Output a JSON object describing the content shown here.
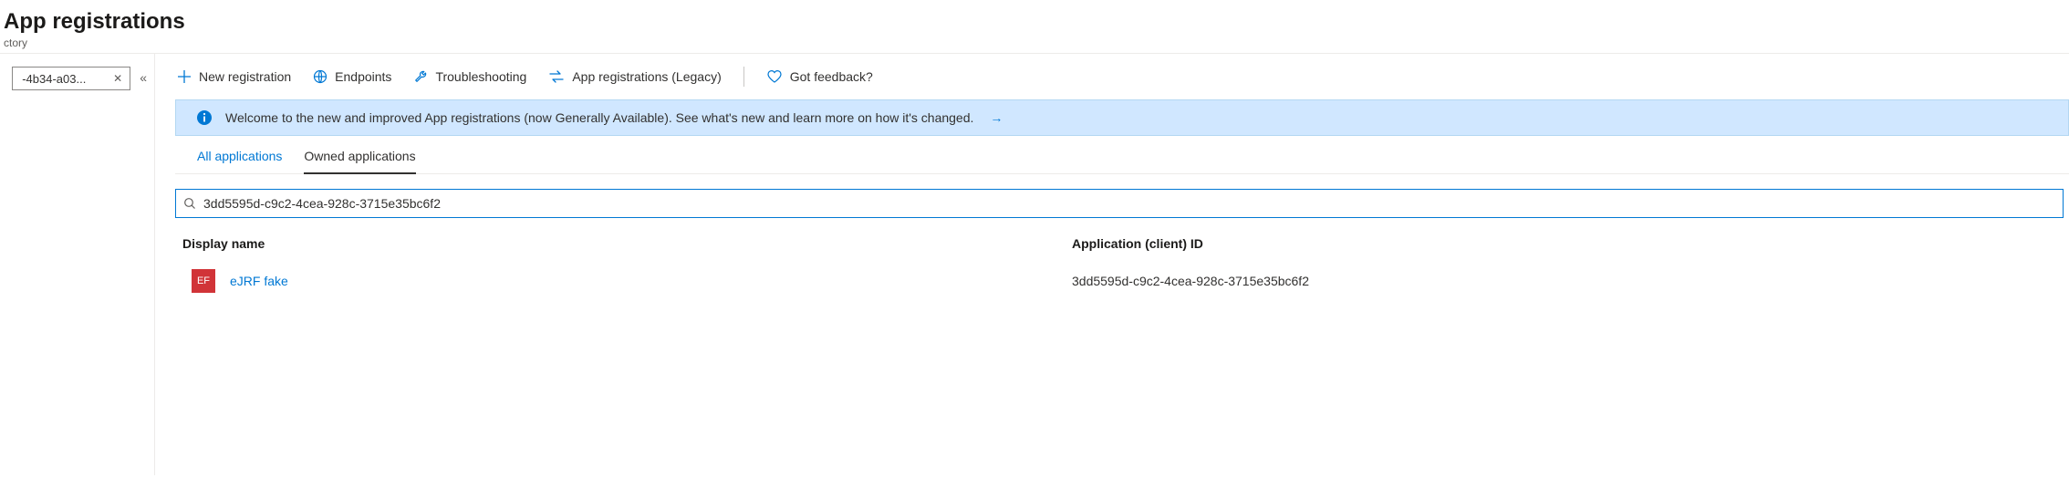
{
  "header": {
    "title": "App registrations",
    "breadcrumb": "ctory"
  },
  "left_rail": {
    "pill_text": "-4b34-a03..."
  },
  "toolbar": {
    "new_registration": "New registration",
    "endpoints": "Endpoints",
    "troubleshooting": "Troubleshooting",
    "legacy": "App registrations (Legacy)",
    "feedback": "Got feedback?"
  },
  "banner": {
    "text": "Welcome to the new and improved App registrations (now Generally Available). See what's new and learn more on how it's changed."
  },
  "tabs": {
    "all": "All applications",
    "owned": "Owned applications"
  },
  "search": {
    "value": "3dd5595d-c9c2-4cea-928c-3715e35bc6f2"
  },
  "table": {
    "headers": {
      "display_name": "Display name",
      "app_id": "Application (client) ID"
    },
    "rows": [
      {
        "badge": "EF",
        "name": "eJRF fake",
        "app_id": "3dd5595d-c9c2-4cea-928c-3715e35bc6f2"
      }
    ]
  }
}
